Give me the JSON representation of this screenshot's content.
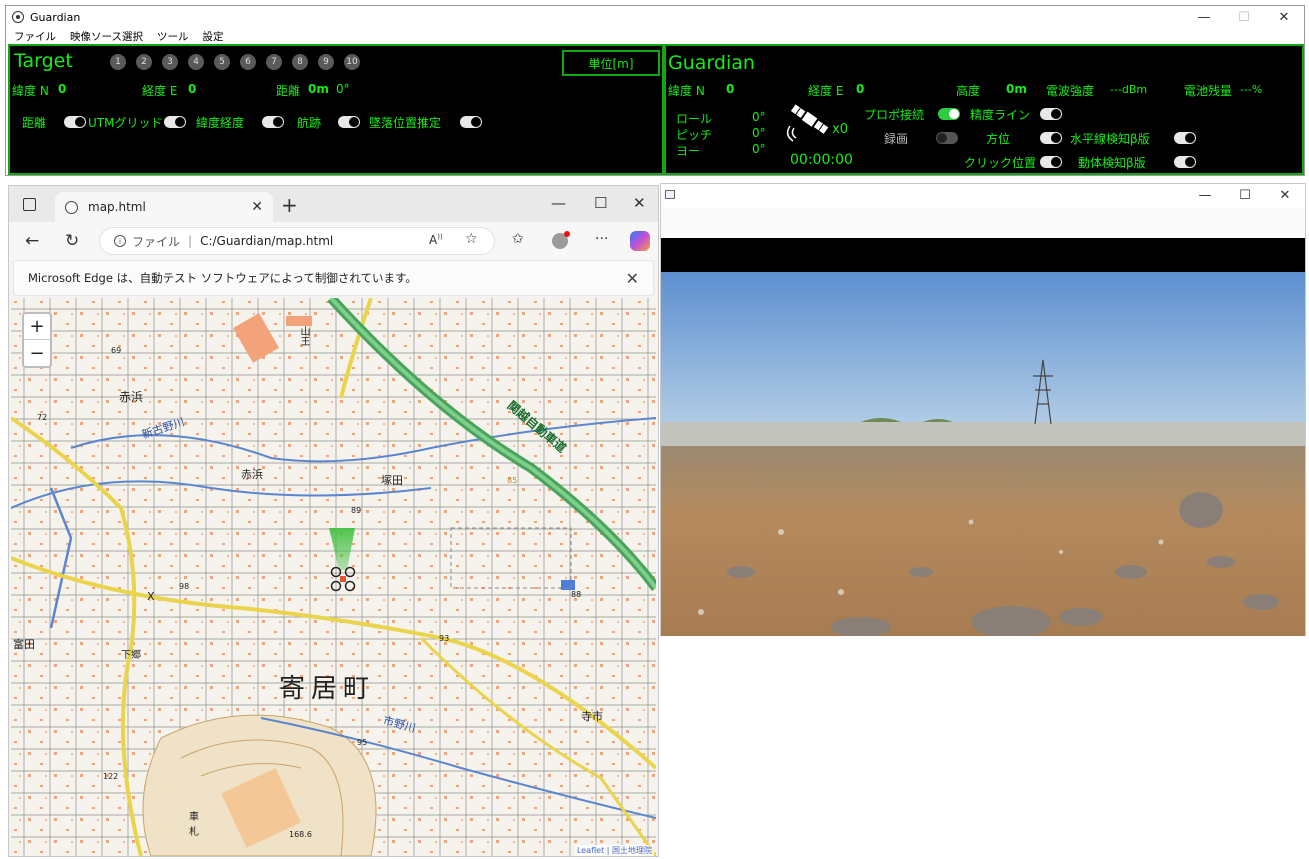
{
  "app": {
    "title": "Guardian",
    "menu": [
      "ファイル",
      "映像ソース選択",
      "ツール",
      "設定"
    ],
    "window_controls": {
      "minimize": "—",
      "maximize": "☐",
      "close": "✕"
    }
  },
  "target": {
    "heading": "Target",
    "waypoints": [
      "1",
      "2",
      "3",
      "4",
      "5",
      "6",
      "7",
      "8",
      "9",
      "10"
    ],
    "unit_button": "単位[m]",
    "lat_label": "緯度 N",
    "lat_value": "0",
    "lon_label": "経度 E",
    "lon_value": "0",
    "dist_label": "距離",
    "dist_value": "0m",
    "dist_angle": "0°",
    "toggles": [
      {
        "label": "距離",
        "on": false
      },
      {
        "label": "UTMグリッド",
        "on": false
      },
      {
        "label": "緯度経度",
        "on": false
      },
      {
        "label": "航跡",
        "on": false
      },
      {
        "label": "墜落位置推定",
        "on": false
      }
    ]
  },
  "guardian": {
    "heading": "Guardian",
    "lat_label": "緯度 N",
    "lat_value": "0",
    "lon_label": "経度 E",
    "lon_value": "0",
    "alt_label": "高度",
    "alt_value": "0m",
    "signal_label": "電波強度",
    "signal_value": "---dBm",
    "battery_label": "電池残量",
    "battery_value": "---%",
    "roll_label": "ロール",
    "roll_value": "0°",
    "pitch_label": "ピッチ",
    "pitch_value": "0°",
    "yaw_label": "ヨー",
    "yaw_value": "0°",
    "satellite_count": "x0",
    "timer": "00:00:00",
    "toggles": {
      "propo": {
        "label": "プロポ接続",
        "on": true
      },
      "accuracy": {
        "label": "精度ライン",
        "on": false
      },
      "record": {
        "label": "録画",
        "on": false
      },
      "bearing": {
        "label": "方位",
        "on": false
      },
      "horizon": {
        "label": "水平線検知β版",
        "on": false
      },
      "click": {
        "label": "クリック位置",
        "on": false
      },
      "motion": {
        "label": "動体検知β版",
        "on": false
      }
    },
    "satellite_icon": "satellite-icon"
  },
  "browser": {
    "tab_title": "map.html",
    "new_tab": "+",
    "url_scheme": "ファイル",
    "url": "C:/Guardian/map.html",
    "info_bar": "Microsoft Edge は、自動テスト ソフトウェアによって制御されています。",
    "zoom_in": "+",
    "zoom_out": "−"
  },
  "map": {
    "labels": {
      "akahama": "赤浜",
      "akahama2": "赤浜",
      "shinkanogawa": "新古野川",
      "tsukada": "塚田",
      "tomita": "富田",
      "shimogo": "下郷",
      "yorii": "寄居町",
      "ichinokawa": "市野川",
      "teraichi": "寺市",
      "expressway": "関越自動車道",
      "yama": "山王",
      "kuruma": "車",
      "fuda": "札",
      "x": "X"
    },
    "elevations": [
      "69",
      "72",
      "98",
      "89",
      "93",
      "88",
      "95",
      "85",
      "122",
      "168.6"
    ],
    "attribution": "Leaflet | 国土地理院"
  },
  "video": {
    "window_controls": {
      "minimize": "—",
      "maximize": "☐",
      "close": "✕"
    }
  }
}
